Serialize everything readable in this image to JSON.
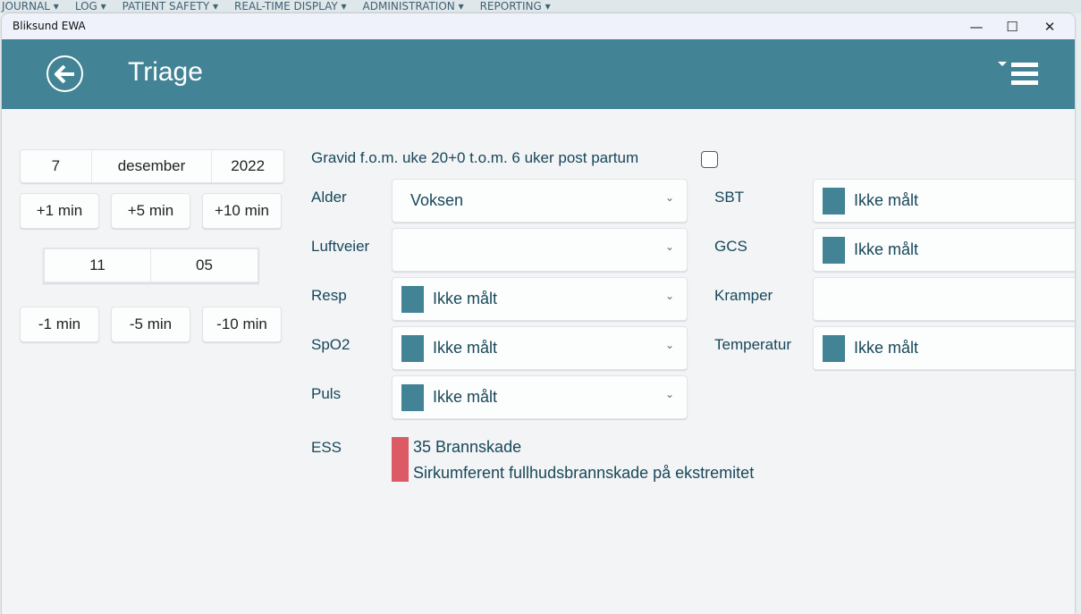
{
  "background_menu": [
    "JOURNAL ▾",
    "LOG ▾",
    "PATIENT SAFETY ▾",
    "REAL-TIME DISPLAY ▾",
    "ADMINISTRATION ▾",
    "REPORTING ▾"
  ],
  "window": {
    "title": "Bliksund EWA",
    "minimize": "—",
    "maximize": "☐",
    "close": "✕"
  },
  "header": {
    "title": "Triage",
    "back_icon": "arrow-left-circle-icon",
    "menu_icon": "hamburger-dropdown-icon",
    "color": "#428395"
  },
  "date": {
    "day": "7",
    "month": "desember",
    "year": "2022"
  },
  "time": {
    "hour": "11",
    "minute": "05"
  },
  "plus_buttons": [
    "+1 min",
    "+5 min",
    "+10 min"
  ],
  "minus_buttons": [
    "-1 min",
    "-5 min",
    "-10 min"
  ],
  "pregnant": {
    "label": "Gravid f.o.m. uke 20+0 t.o.m. 6 uker post partum",
    "checked": false
  },
  "left_fields": [
    {
      "label": "Alder",
      "value": "Voksen",
      "swatch": false
    },
    {
      "label": "Luftveier",
      "value": "",
      "swatch": false
    },
    {
      "label": "Resp",
      "value": "Ikke målt",
      "swatch": true
    },
    {
      "label": "SpO2",
      "value": "Ikke målt",
      "swatch": true
    },
    {
      "label": "Puls",
      "value": "Ikke målt",
      "swatch": true
    }
  ],
  "right_fields": [
    {
      "label": "SBT",
      "value": "Ikke målt",
      "swatch": true
    },
    {
      "label": "GCS",
      "value": "Ikke målt",
      "swatch": true
    },
    {
      "label": "Kramper",
      "value": "",
      "swatch": false
    },
    {
      "label": "Temperatur",
      "value": "Ikke målt",
      "swatch": true
    }
  ],
  "ess": {
    "label": "ESS",
    "code": "35 Brannskade",
    "description": "Sirkumferent fullhudsbrannskade på ekstremitet",
    "color": "#dc5a66"
  },
  "swatch_color": "#428395"
}
